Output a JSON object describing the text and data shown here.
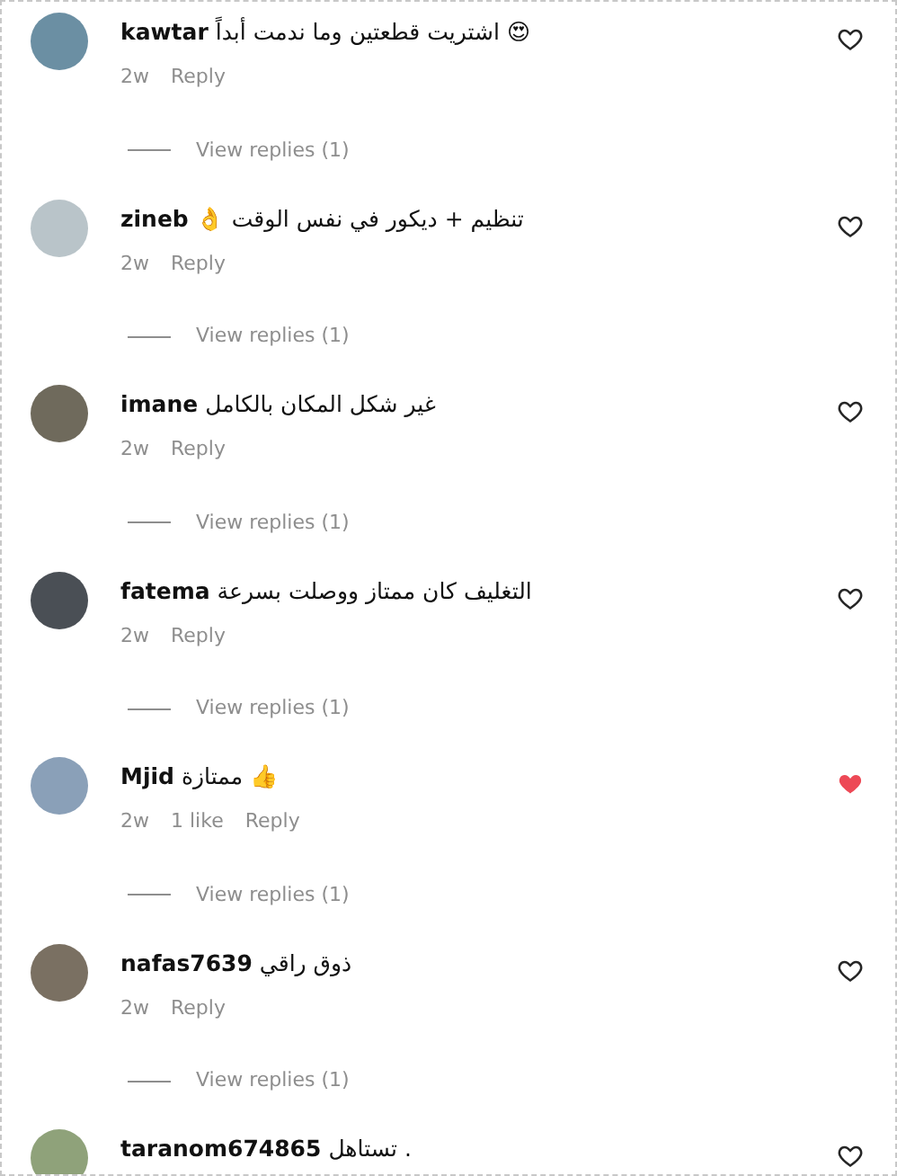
{
  "comments": [
    {
      "username": "kawtar",
      "text": "اشتريت قطعتين وما ندمت أبداً 😍",
      "time": "2w",
      "reply": "Reply",
      "liked": false,
      "view_replies": "View replies (1)"
    },
    {
      "username": "zineb",
      "text": "👌 تنظيم + ديكور في نفس الوقت",
      "time": "2w",
      "reply": "Reply",
      "liked": false,
      "view_replies": "View replies (1)"
    },
    {
      "username": "imane",
      "text": "غير شكل المكان بالكامل",
      "time": "2w",
      "reply": "Reply",
      "liked": false,
      "view_replies": "View replies (1)"
    },
    {
      "username": "fatema",
      "text": "التغليف كان ممتاز ووصلت بسرعة",
      "time": "2w",
      "reply": "Reply",
      "liked": false,
      "view_replies": "View replies (1)"
    },
    {
      "username": "Mjid",
      "text": "ممتازة 👍",
      "time": "2w",
      "likes": "1 like",
      "reply": "Reply",
      "liked": true,
      "view_replies": "View replies (1)"
    },
    {
      "username": "nafas7639",
      "text": "ذوق راقي",
      "time": "2w",
      "reply": "Reply",
      "liked": false,
      "view_replies": "View replies (1)"
    },
    {
      "username": "taranom674865",
      "text": "تستاهل .",
      "liked": false
    }
  ]
}
